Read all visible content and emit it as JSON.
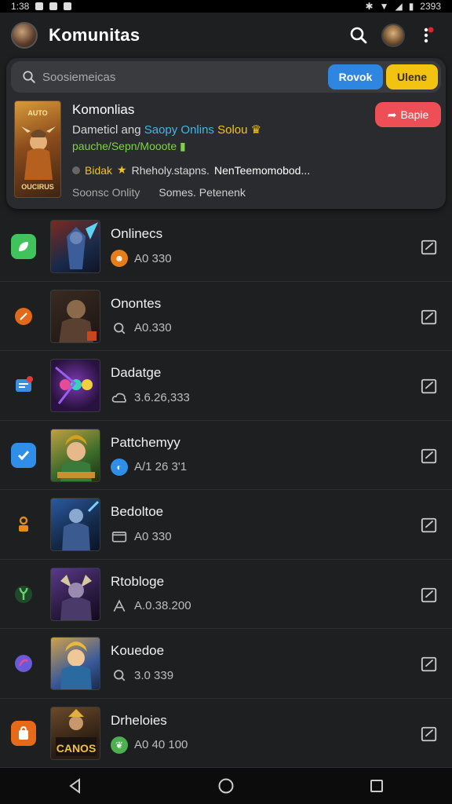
{
  "status_bar": {
    "time": "1:38",
    "battery": "2393"
  },
  "app": {
    "title": "Komunitas"
  },
  "search": {
    "placeholder": "Soosiemeicas",
    "btn_blue": "Rovok",
    "btn_yellow": "Ulene"
  },
  "featured": {
    "cover_top": "AUTO",
    "cover_caption": "OUCIRUS",
    "title": "Komonlias",
    "line1_prefix": "Dameticl ang ",
    "line1_highlight": "Saopy Onlins",
    "line1_highlight2": " Solou",
    "line2": "pauche/Sepn/Mooote",
    "line3_highlight": "Bidak",
    "line3_text": "Rheholy.stapns.",
    "line3_bold": "NenTeemomobod...",
    "line4_a": "Soonsc Onlity",
    "line4_b": "Somes. Petenenk",
    "red_button": "Bapie"
  },
  "items": [
    {
      "title": "Onlinecs",
      "meta": "A0 330",
      "icon_color": "#3fc35a",
      "meta_color": "#e77d1a"
    },
    {
      "title": "Onontes",
      "meta": "A0.330",
      "icon_color": "#e06a1a",
      "meta_color": "#888888"
    },
    {
      "title": "Dadatge",
      "meta": "3.6.26,333",
      "icon_color": "#3a8ee0",
      "meta_color": "#888888"
    },
    {
      "title": "Pattchemyy",
      "meta": "A/1 26 3'1",
      "icon_color": "#2f8fe8",
      "meta_color": "#2f8fe8"
    },
    {
      "title": "Bedoltoe",
      "meta": "A0 330",
      "icon_color": "#e68a1a",
      "meta_color": "#888888"
    },
    {
      "title": "Rtobloge",
      "meta": "A.0.38.200",
      "icon_color": "#4caf50",
      "meta_color": "#888888"
    },
    {
      "title": "Kouedoe",
      "meta": "3.0 339",
      "icon_color": "#6a5ad8",
      "meta_color": "#888888"
    },
    {
      "title": "Drheloies",
      "meta": "A0 40 100",
      "icon_color": "#e66a1a",
      "meta_color": "#4caf50"
    }
  ],
  "icons": {
    "search": "search-icon",
    "more": "more-vert-icon",
    "edit": "edit-square-icon",
    "back": "back-icon",
    "home": "home-icon",
    "recents": "recents-icon"
  }
}
